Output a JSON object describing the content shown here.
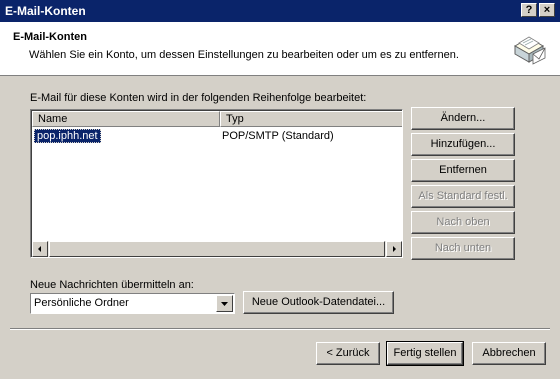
{
  "window": {
    "title": "E-Mail-Konten",
    "help_label": "?",
    "close_label": "×"
  },
  "header": {
    "title": "E-Mail-Konten",
    "description": "Wählen Sie ein Konto, um dessen Einstellungen zu bearbeiten oder um es zu entfernen.",
    "icon": "mail-accounts-icon"
  },
  "accounts": {
    "caption": "E-Mail für diese Konten wird in der folgenden Reihenfolge bearbeitet:",
    "columns": [
      "Name",
      "Typ"
    ],
    "rows": [
      {
        "name": "pop.iphh.net",
        "type": "POP/SMTP (Standard)"
      }
    ]
  },
  "side_buttons": {
    "change": "Ändern...",
    "add": "Hinzufügen...",
    "remove": "Entfernen",
    "set_default": "Als Standard festl.",
    "move_up": "Nach oben",
    "move_down": "Nach unten"
  },
  "delivery": {
    "label": "Neue Nachrichten übermitteln an:",
    "selected": "Persönliche Ordner",
    "new_datafile_button": "Neue Outlook-Datendatei..."
  },
  "footer": {
    "back": "< Zurück",
    "finish": "Fertig stellen",
    "cancel": "Abbrechen"
  }
}
